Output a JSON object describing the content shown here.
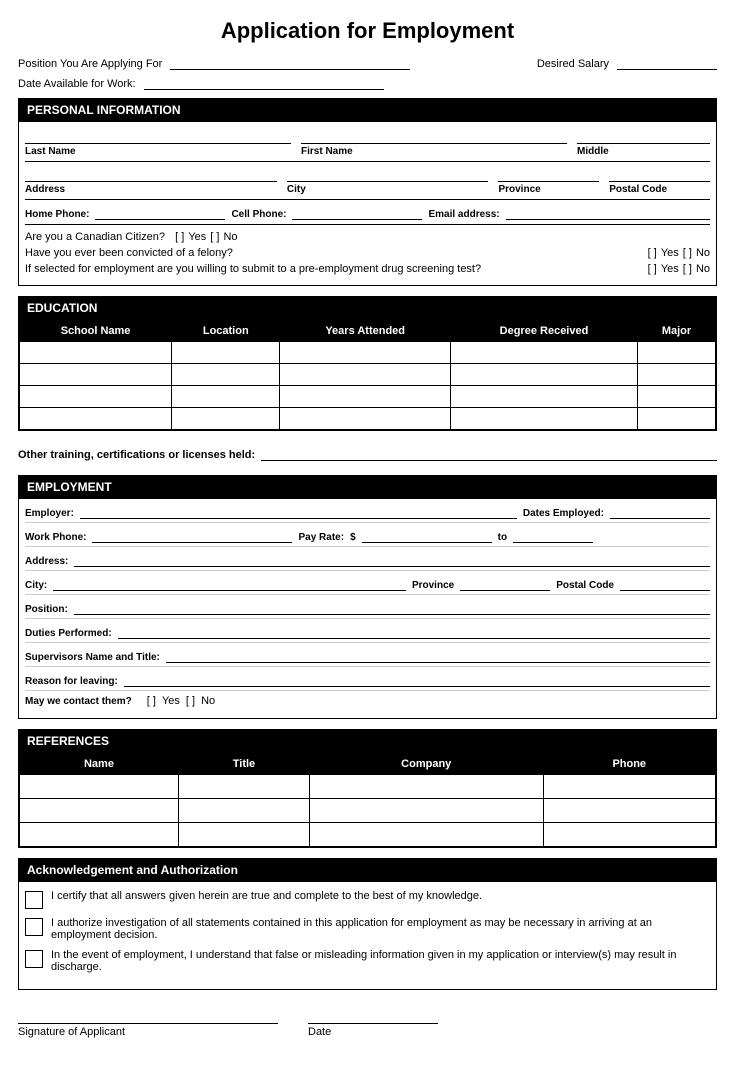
{
  "title": "Application for Employment",
  "top": {
    "position_label": "Position You Are Applying For",
    "desired_salary_label": "Desired Salary",
    "date_available_label": "Date Available for Work:"
  },
  "personal": {
    "header": "PERSONAL INFORMATION",
    "last_name_label": "Last Name",
    "first_name_label": "First Name",
    "middle_label": "Middle",
    "address_label": "Address",
    "city_label": "City",
    "province_label": "Province",
    "postal_code_label": "Postal Code",
    "home_phone_label": "Home Phone:",
    "cell_phone_label": "Cell Phone:",
    "email_label": "Email address:",
    "canadian_q": "Are you a  Canadian Citizen?",
    "felony_q": "Have you ever been convicted of a felony?",
    "drug_q": "If selected for employment are you willing to submit to a pre-employment drug screening test?",
    "yes_label": "Yes",
    "no_label": "No"
  },
  "education": {
    "header": "EDUCATION",
    "columns": [
      "School Name",
      "Location",
      "Years Attended",
      "Degree Received",
      "Major"
    ],
    "rows": [
      [
        "",
        "",
        "",
        "",
        ""
      ],
      [
        "",
        "",
        "",
        "",
        ""
      ],
      [
        "",
        "",
        "",
        "",
        ""
      ],
      [
        "",
        "",
        "",
        "",
        ""
      ]
    ],
    "other_training_label": "Other training, certifications or licenses held:"
  },
  "employment": {
    "header": "EMPLOYMENT",
    "employer_label": "Employer:",
    "dates_employed_label": "Dates Employed:",
    "work_phone_label": "Work Phone:",
    "pay_rate_label": "Pay Rate:",
    "dollar_sign": "$",
    "to_label": "to",
    "address_label": "Address:",
    "city_label": "City:",
    "province_label": "Province",
    "postal_code_label": "Postal Code",
    "position_label": "Position:",
    "duties_label": "Duties Performed:",
    "supervisor_label": "Supervisors Name and Title:",
    "reason_label": "Reason for leaving:",
    "contact_label": "May we contact them?",
    "yes_label": "Yes",
    "no_label": "No"
  },
  "references": {
    "header": "REFERENCES",
    "columns": [
      "Name",
      "Title",
      "Company",
      "Phone"
    ],
    "rows": [
      [
        "",
        "",
        "",
        ""
      ],
      [
        "",
        "",
        "",
        ""
      ],
      [
        "",
        "",
        "",
        ""
      ]
    ]
  },
  "acknowledgement": {
    "header": "Acknowledgement and Authorization",
    "items": [
      "I certify that all answers given herein are true and complete to the best of my knowledge.",
      "I authorize investigation of all statements contained in this application for employment as may be necessary in arriving at an employment decision.",
      "In the event of employment, I understand that false or misleading information given in my application or interview(s) may result in discharge."
    ],
    "signature_label": "Signature of  Applicant",
    "date_label": "Date"
  }
}
